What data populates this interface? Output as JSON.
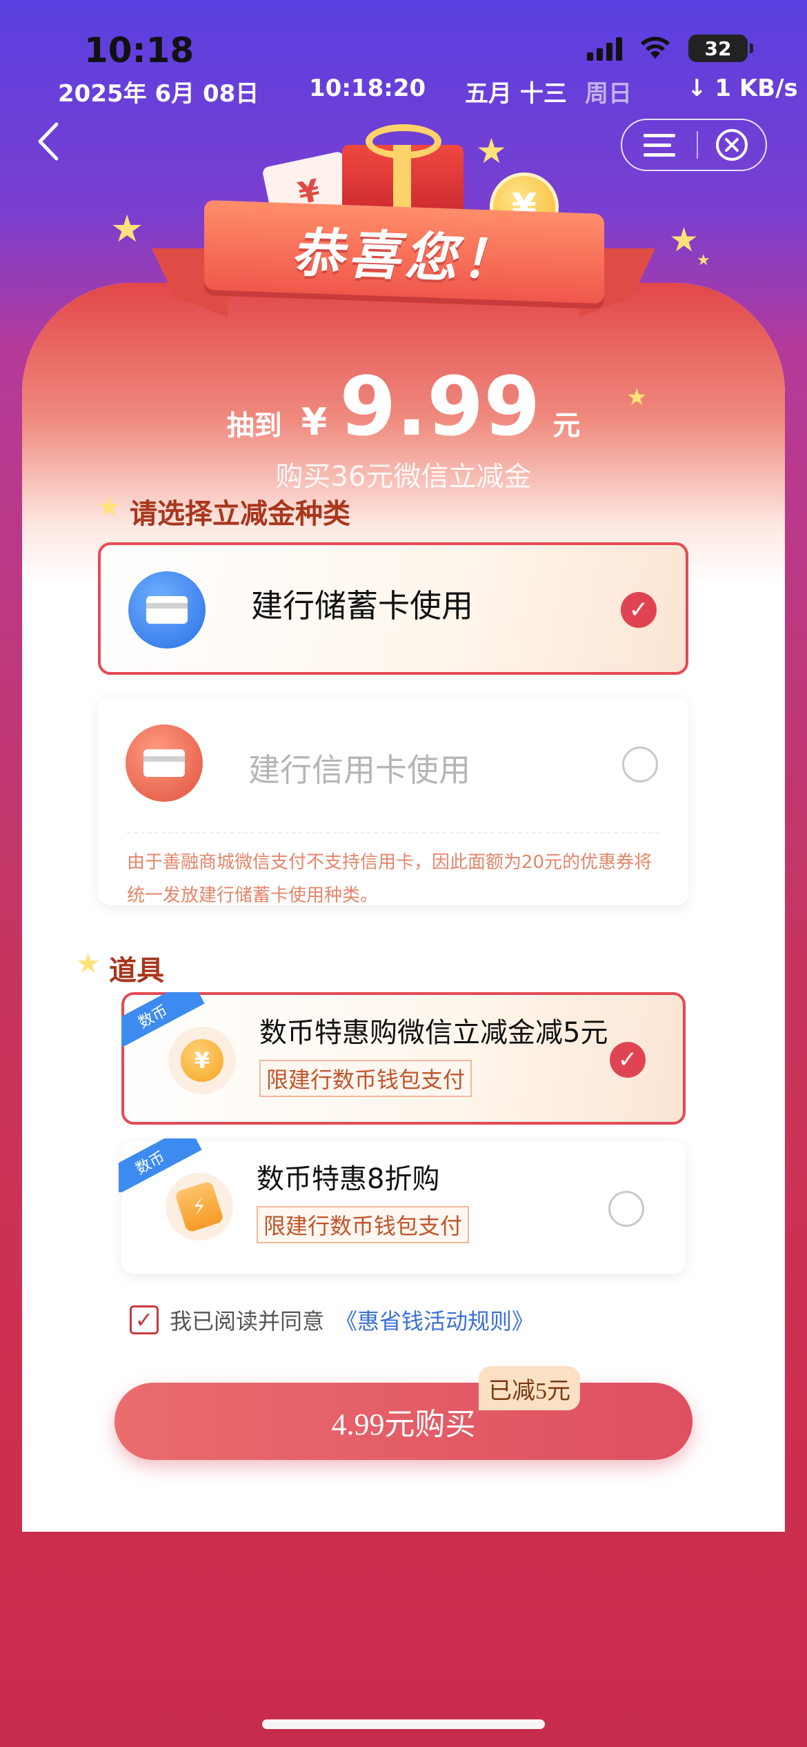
{
  "status_bar": {
    "time": "10:18",
    "battery": "32",
    "date": "2025年 6月 08日",
    "clock": "10:18:20",
    "lunar": "五月 十三",
    "weekday": "周日",
    "speed": "↓ 1 KB/s"
  },
  "nav": {
    "back_icon": "chevron-left-icon",
    "menu_icon": "menu-icon",
    "close_icon": "close-circle-icon"
  },
  "banner": {
    "title": "恭喜您！",
    "currency_glyph": "¥"
  },
  "prize": {
    "prefix": "抽到",
    "currency": "¥",
    "amount": "9.99",
    "unit": "元",
    "subtitle": "购买36元微信立减金"
  },
  "type_section": {
    "title": "请选择立减金种类",
    "options": [
      {
        "label": "建行储蓄卡使用",
        "selected": true,
        "icon": "debit-card-icon"
      },
      {
        "label": "建行信用卡使用",
        "selected": false,
        "icon": "credit-card-icon"
      }
    ],
    "note": "由于善融商城微信支付不支持信用卡，因此面额为20元的优惠券将统一发放建行储蓄卡使用种类。"
  },
  "props_section": {
    "title": "道具",
    "items": [
      {
        "corner": "数币",
        "title": "数币特惠购微信立减金减5元",
        "tag": "限建行数币钱包支付",
        "selected": true,
        "icon": "yuan-coin-icon",
        "glyph": "¥"
      },
      {
        "corner": "数币",
        "title": "数币特惠8折购",
        "tag": "限建行数币钱包支付",
        "selected": false,
        "icon": "discount-tag-icon",
        "glyph": "⚡"
      }
    ]
  },
  "agreement": {
    "checked": true,
    "text": "我已阅读并同意",
    "link": "《惠省钱活动规则》"
  },
  "purchase": {
    "button_label": "4.99元购买",
    "badge": "已减5元"
  },
  "colors": {
    "accent": "#e04452",
    "link": "#3b6fd6",
    "section_title": "#a8361c"
  }
}
